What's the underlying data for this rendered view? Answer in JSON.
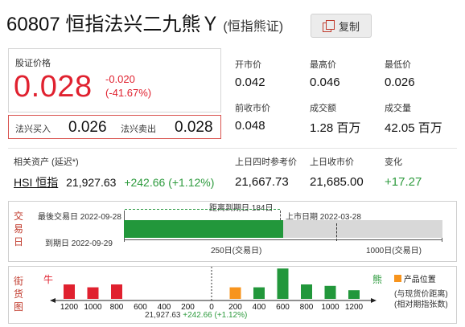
{
  "header": {
    "code_name": "60807 恒指法兴二九熊Ｙ",
    "subtitle": "(恒指熊证)",
    "copy_label": "复制"
  },
  "price": {
    "label": "股证价格",
    "value": "0.028",
    "change": "-0.020",
    "change_pct": "(-41.67%)"
  },
  "buy_sell": {
    "buy_label": "法兴买入",
    "buy_value": "0.026",
    "sell_label": "法兴卖出",
    "sell_value": "0.028"
  },
  "stats": {
    "open_label": "开市价",
    "open": "0.042",
    "high_label": "最高价",
    "high": "0.046",
    "low_label": "最低价",
    "low": "0.026",
    "prev_label": "前收市价",
    "prev": "0.048",
    "turnover_label": "成交额",
    "turnover": "1.28 百万",
    "volume_label": "成交量",
    "volume": "42.05 百万"
  },
  "underlying": {
    "label": "相关资产 (延迟*)",
    "name": "HSI 恒指",
    "price": "21,927.63",
    "change": "+242.66 (+1.12%)",
    "ref4_label": "上日四时参考价",
    "ref4": "21,667.73",
    "close_label": "上日收市价",
    "close": "21,685.00",
    "var_label": "变化",
    "var": "+17.27"
  },
  "timeline": {
    "side_label": [
      "交",
      "易",
      "日"
    ],
    "last_trade": "最後交易日 2022-09-28",
    "expiry": "到期日 2022-09-29",
    "remaining": "距离到期日 184日",
    "listing": "上市日期 2022-03-28",
    "days_250": "250日(交易日)",
    "days_1000": "1000日(交易日)",
    "remaining_days": 184,
    "elapsed_fraction": 0.5
  },
  "street": {
    "side_label": [
      "街",
      "货",
      "图"
    ],
    "bull_label": "牛",
    "bear_label": "熊",
    "legend_label": "产品位置",
    "note_line1": "(与现货价距离)",
    "note_line2": "(相对期指张数)",
    "ticks": [
      "1200",
      "1000",
      "800",
      "600",
      "400",
      "200",
      "0",
      "200",
      "400",
      "600",
      "800",
      "1000",
      "1200"
    ],
    "footer_price": "21,927.63",
    "footer_change": "+242.66 (+1.12%)",
    "colors": {
      "bull": "#e0212f",
      "bear": "#22973b",
      "product": "#f7941d"
    }
  },
  "chart_data": {
    "type": "bar",
    "categories": [
      "1200",
      "1000",
      "800",
      "600",
      "400",
      "200",
      "0",
      "200",
      "400",
      "600",
      "800",
      "1000",
      "1200"
    ],
    "series": [
      {
        "name": "牛",
        "values": [
          2,
          1.6,
          2,
          0,
          0,
          0,
          0,
          0,
          0,
          0,
          0,
          0,
          0
        ]
      },
      {
        "name": "熊",
        "values": [
          0,
          0,
          0,
          0,
          0,
          0,
          0,
          1.6,
          1.6,
          4.2,
          2,
          1.8,
          1.2
        ]
      }
    ],
    "product_position": "200"
  }
}
